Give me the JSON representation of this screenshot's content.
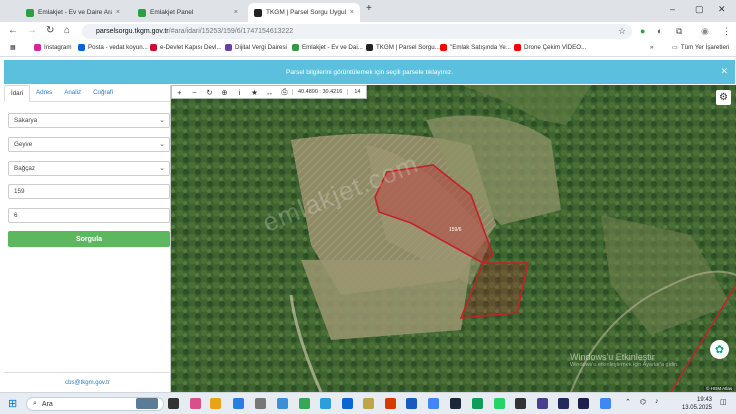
{
  "browser": {
    "tabs": [
      {
        "title": "Emlakjet - Ev ve Daire Aramanın",
        "color": "#2e9e46"
      },
      {
        "title": "Emlakjet Panel",
        "color": "#2e9e46"
      },
      {
        "title": "TKGM | Parsel Sorgu Uygulaması",
        "color": "#222222"
      }
    ],
    "new_tab_label": "+",
    "url_host": "parselsorgu.tkgm.gov.tr",
    "url_path": "/#ara/idari/15253/159/6/1747154613222",
    "bookmarks": [
      {
        "label": "Instagram",
        "color": "#d6249f"
      },
      {
        "label": "Posta - vedat koyun...",
        "color": "#0a64d1"
      },
      {
        "label": "e-Devlet Kapısı Devl...",
        "color": "#c8102e"
      },
      {
        "label": "Dijital Vergi Dairesi",
        "color": "#6b3fa0"
      },
      {
        "label": "Emlakjet - Ev ve Dai...",
        "color": "#2e9e46"
      },
      {
        "label": "TKGM | Parsel Sorgu...",
        "color": "#222222"
      },
      {
        "label": "\"Emlak Satışında Ye...",
        "color": "#ff0000"
      },
      {
        "label": "Drone Çekim VİDEO...",
        "color": "#ff0000"
      }
    ],
    "all_bookmarks": "Tüm Yer İşaretleri"
  },
  "notice": {
    "text": "Parsel bilgilerini görüntülemek için seçili parsele tıklayınız."
  },
  "sidebar": {
    "tabs": [
      "İdari",
      "Adres",
      "Analiz",
      "Coğrafi"
    ],
    "province": "Sakarya",
    "district": "Geyve",
    "neighborhood": "Bağçaz",
    "block": "159",
    "parcel": "6",
    "query_button": "Sorgula",
    "footer_email": "cbs@tkgm.gov.tr"
  },
  "map": {
    "coordinates": "40.4890 : 30.4216",
    "zoom": "14",
    "parcel_label": "159/6",
    "watermark": "emlakjet.com",
    "activate_title": "Windows'u Etkinleştir",
    "activate_sub": "Windows'u etkinleştirmek için Ayarlar'a gidin.",
    "attribution": "© HGM Atlas",
    "parcel_color": "#c2222a"
  },
  "taskbar": {
    "search_placeholder": "Ara",
    "time": "19:43",
    "date": "13.05.2025"
  }
}
